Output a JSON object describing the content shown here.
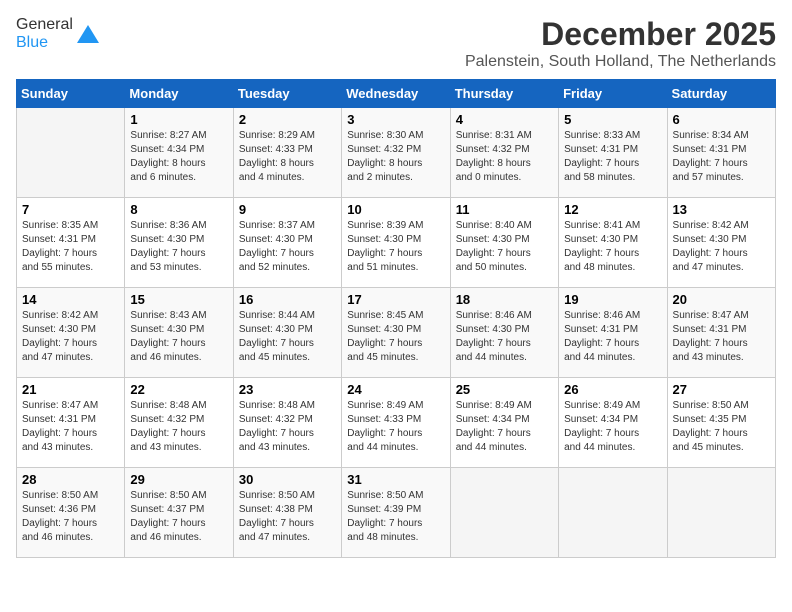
{
  "header": {
    "logo_line1": "General",
    "logo_line2": "Blue",
    "month": "December 2025",
    "location": "Palenstein, South Holland, The Netherlands"
  },
  "days_of_week": [
    "Sunday",
    "Monday",
    "Tuesday",
    "Wednesday",
    "Thursday",
    "Friday",
    "Saturday"
  ],
  "weeks": [
    [
      {
        "day": "",
        "info": ""
      },
      {
        "day": "1",
        "info": "Sunrise: 8:27 AM\nSunset: 4:34 PM\nDaylight: 8 hours\nand 6 minutes."
      },
      {
        "day": "2",
        "info": "Sunrise: 8:29 AM\nSunset: 4:33 PM\nDaylight: 8 hours\nand 4 minutes."
      },
      {
        "day": "3",
        "info": "Sunrise: 8:30 AM\nSunset: 4:32 PM\nDaylight: 8 hours\nand 2 minutes."
      },
      {
        "day": "4",
        "info": "Sunrise: 8:31 AM\nSunset: 4:32 PM\nDaylight: 8 hours\nand 0 minutes."
      },
      {
        "day": "5",
        "info": "Sunrise: 8:33 AM\nSunset: 4:31 PM\nDaylight: 7 hours\nand 58 minutes."
      },
      {
        "day": "6",
        "info": "Sunrise: 8:34 AM\nSunset: 4:31 PM\nDaylight: 7 hours\nand 57 minutes."
      }
    ],
    [
      {
        "day": "7",
        "info": "Sunrise: 8:35 AM\nSunset: 4:31 PM\nDaylight: 7 hours\nand 55 minutes."
      },
      {
        "day": "8",
        "info": "Sunrise: 8:36 AM\nSunset: 4:30 PM\nDaylight: 7 hours\nand 53 minutes."
      },
      {
        "day": "9",
        "info": "Sunrise: 8:37 AM\nSunset: 4:30 PM\nDaylight: 7 hours\nand 52 minutes."
      },
      {
        "day": "10",
        "info": "Sunrise: 8:39 AM\nSunset: 4:30 PM\nDaylight: 7 hours\nand 51 minutes."
      },
      {
        "day": "11",
        "info": "Sunrise: 8:40 AM\nSunset: 4:30 PM\nDaylight: 7 hours\nand 50 minutes."
      },
      {
        "day": "12",
        "info": "Sunrise: 8:41 AM\nSunset: 4:30 PM\nDaylight: 7 hours\nand 48 minutes."
      },
      {
        "day": "13",
        "info": "Sunrise: 8:42 AM\nSunset: 4:30 PM\nDaylight: 7 hours\nand 47 minutes."
      }
    ],
    [
      {
        "day": "14",
        "info": "Sunrise: 8:42 AM\nSunset: 4:30 PM\nDaylight: 7 hours\nand 47 minutes."
      },
      {
        "day": "15",
        "info": "Sunrise: 8:43 AM\nSunset: 4:30 PM\nDaylight: 7 hours\nand 46 minutes."
      },
      {
        "day": "16",
        "info": "Sunrise: 8:44 AM\nSunset: 4:30 PM\nDaylight: 7 hours\nand 45 minutes."
      },
      {
        "day": "17",
        "info": "Sunrise: 8:45 AM\nSunset: 4:30 PM\nDaylight: 7 hours\nand 45 minutes."
      },
      {
        "day": "18",
        "info": "Sunrise: 8:46 AM\nSunset: 4:30 PM\nDaylight: 7 hours\nand 44 minutes."
      },
      {
        "day": "19",
        "info": "Sunrise: 8:46 AM\nSunset: 4:31 PM\nDaylight: 7 hours\nand 44 minutes."
      },
      {
        "day": "20",
        "info": "Sunrise: 8:47 AM\nSunset: 4:31 PM\nDaylight: 7 hours\nand 43 minutes."
      }
    ],
    [
      {
        "day": "21",
        "info": "Sunrise: 8:47 AM\nSunset: 4:31 PM\nDaylight: 7 hours\nand 43 minutes."
      },
      {
        "day": "22",
        "info": "Sunrise: 8:48 AM\nSunset: 4:32 PM\nDaylight: 7 hours\nand 43 minutes."
      },
      {
        "day": "23",
        "info": "Sunrise: 8:48 AM\nSunset: 4:32 PM\nDaylight: 7 hours\nand 43 minutes."
      },
      {
        "day": "24",
        "info": "Sunrise: 8:49 AM\nSunset: 4:33 PM\nDaylight: 7 hours\nand 44 minutes."
      },
      {
        "day": "25",
        "info": "Sunrise: 8:49 AM\nSunset: 4:34 PM\nDaylight: 7 hours\nand 44 minutes."
      },
      {
        "day": "26",
        "info": "Sunrise: 8:49 AM\nSunset: 4:34 PM\nDaylight: 7 hours\nand 44 minutes."
      },
      {
        "day": "27",
        "info": "Sunrise: 8:50 AM\nSunset: 4:35 PM\nDaylight: 7 hours\nand 45 minutes."
      }
    ],
    [
      {
        "day": "28",
        "info": "Sunrise: 8:50 AM\nSunset: 4:36 PM\nDaylight: 7 hours\nand 46 minutes."
      },
      {
        "day": "29",
        "info": "Sunrise: 8:50 AM\nSunset: 4:37 PM\nDaylight: 7 hours\nand 46 minutes."
      },
      {
        "day": "30",
        "info": "Sunrise: 8:50 AM\nSunset: 4:38 PM\nDaylight: 7 hours\nand 47 minutes."
      },
      {
        "day": "31",
        "info": "Sunrise: 8:50 AM\nSunset: 4:39 PM\nDaylight: 7 hours\nand 48 minutes."
      },
      {
        "day": "",
        "info": ""
      },
      {
        "day": "",
        "info": ""
      },
      {
        "day": "",
        "info": ""
      }
    ]
  ]
}
